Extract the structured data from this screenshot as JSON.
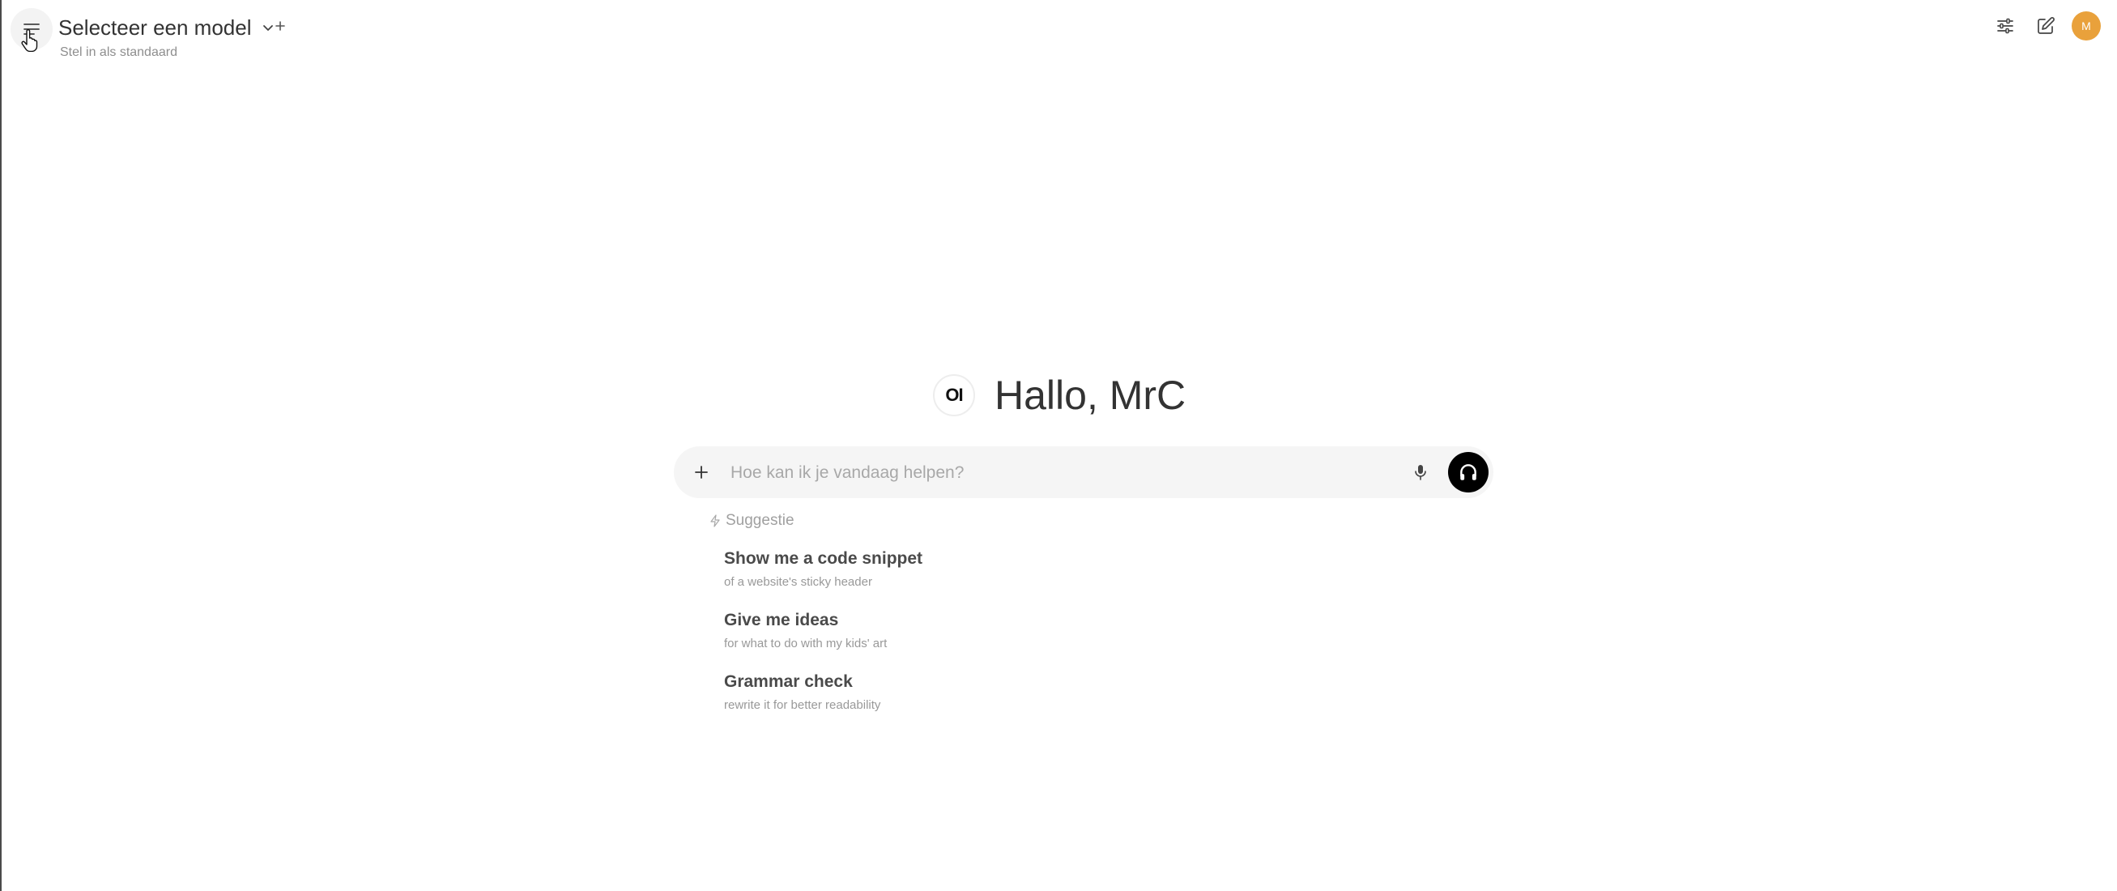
{
  "header": {
    "model_selector_label": "Selecteer een model",
    "set_default_label": "Stel in als standaard",
    "user_initial": "M"
  },
  "icons": {
    "menu": "hamburger-menu-icon",
    "chevron": "chevron-down-icon",
    "add_model": "plus-icon",
    "controls": "sliders-icon",
    "new_chat": "edit-icon",
    "attach": "plus-icon",
    "mic": "microphone-icon",
    "voice": "headphones-icon",
    "suggestion": "bolt-icon"
  },
  "colors": {
    "avatar": "#e9a13b",
    "input_bg": "#f5f5f5",
    "voice_button": "#000000"
  },
  "greeting": {
    "logo_text": "OI",
    "text": "Hallo, MrC"
  },
  "chat_input": {
    "placeholder": "Hoe kan ik je vandaag helpen?",
    "value": ""
  },
  "suggestions": {
    "header": "Suggestie",
    "items": [
      {
        "title": "Show me a code snippet",
        "subtitle": "of a website's sticky header"
      },
      {
        "title": "Give me ideas",
        "subtitle": "for what to do with my kids' art"
      },
      {
        "title": "Grammar check",
        "subtitle": "rewrite it for better readability"
      }
    ]
  }
}
